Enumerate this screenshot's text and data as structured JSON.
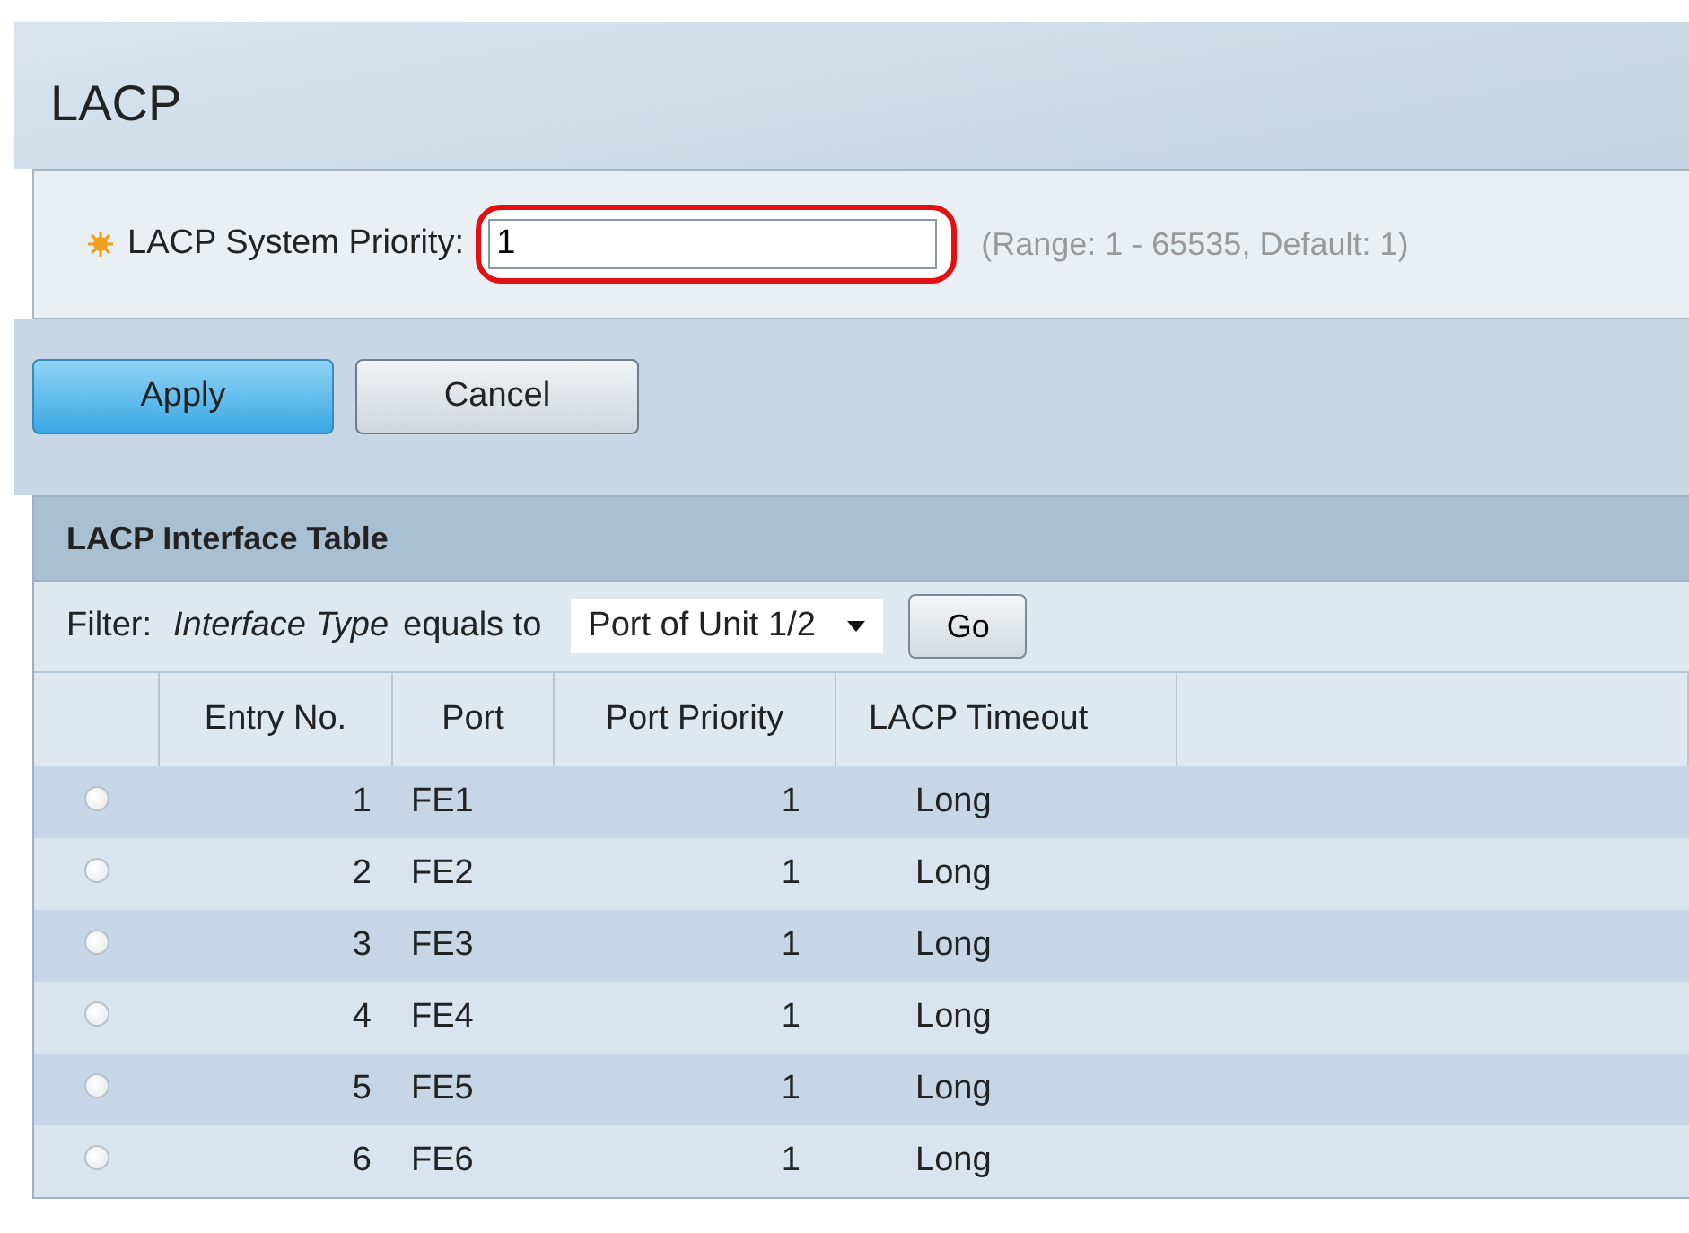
{
  "title": "LACP",
  "priority": {
    "label": "LACP System Priority:",
    "required": true,
    "value": "1",
    "highlighted": true,
    "hint": "(Range: 1 - 65535, Default: 1)"
  },
  "buttons": [
    {
      "label": "Apply",
      "kind": "primary"
    },
    {
      "label": "Cancel",
      "kind": "secondary"
    }
  ],
  "table": {
    "title": "LACP Interface Table",
    "filter": {
      "label": "Filter:",
      "field": "Interface Type",
      "operator": "equals to",
      "value": "Port of Unit 1/2",
      "go": "Go"
    },
    "columns": [
      "Entry No.",
      "Port",
      "Port Priority",
      "LACP Timeout"
    ],
    "rows": [
      {
        "selected": false,
        "cells": [
          "1",
          "FE1",
          "1",
          "Long"
        ]
      },
      {
        "selected": false,
        "cells": [
          "2",
          "FE2",
          "1",
          "Long"
        ]
      },
      {
        "selected": false,
        "cells": [
          "3",
          "FE3",
          "1",
          "Long"
        ]
      },
      {
        "selected": false,
        "cells": [
          "4",
          "FE4",
          "1",
          "Long"
        ]
      },
      {
        "selected": false,
        "cells": [
          "5",
          "FE5",
          "1",
          "Long"
        ]
      },
      {
        "selected": false,
        "cells": [
          "6",
          "FE6",
          "1",
          "Long"
        ]
      }
    ]
  }
}
